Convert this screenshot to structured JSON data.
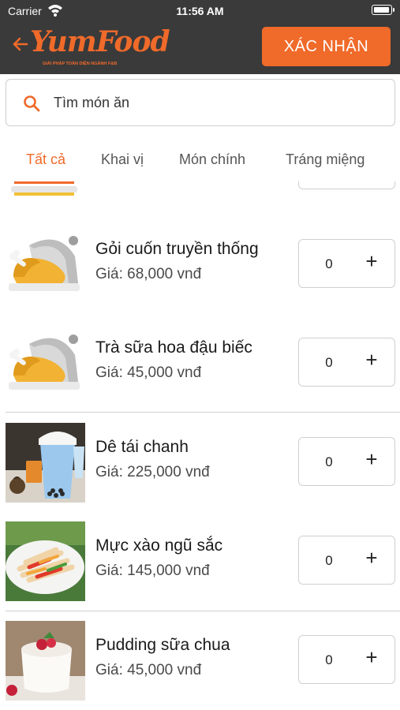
{
  "status_bar": {
    "carrier": "Carrier",
    "time": "11:56 AM"
  },
  "header": {
    "logo_text": "YumFood",
    "logo_tagline": "GIẢI PHÁP TOÀN DIỆN NGÀNH F&B",
    "confirm_label": "XÁC NHẬN"
  },
  "search": {
    "placeholder": "Tìm món ăn"
  },
  "tabs": [
    {
      "label": "Tất cả",
      "active": true
    },
    {
      "label": "Khai vị",
      "active": false
    },
    {
      "label": "Món chính",
      "active": false
    },
    {
      "label": "Tráng miệng",
      "active": false
    }
  ],
  "items": [
    {
      "name": "Gỏi cuốn truyền thống",
      "price": "Giá: 68,000 vnđ",
      "qty": "0",
      "image": "placeholder-cloche"
    },
    {
      "name": "Trà sữa hoa đậu biếc",
      "price": "Giá: 45,000 vnđ",
      "qty": "0",
      "image": "placeholder-cloche"
    },
    {
      "name": "Dê tái chanh",
      "price": "Giá: 225,000 vnđ",
      "qty": "0",
      "image": "bubble-tea-photo"
    },
    {
      "name": "Mực xào ngũ sắc",
      "price": "Giá: 145,000 vnđ",
      "qty": "0",
      "image": "stir-fry-photo"
    },
    {
      "name": "Pudding sữa chua",
      "price": "Giá: 45,000 vnđ",
      "qty": "0",
      "image": "pudding-photo"
    }
  ],
  "colors": {
    "accent": "#f06a2a",
    "header_bg": "#3a3a3a",
    "border": "#cfcfcf"
  }
}
